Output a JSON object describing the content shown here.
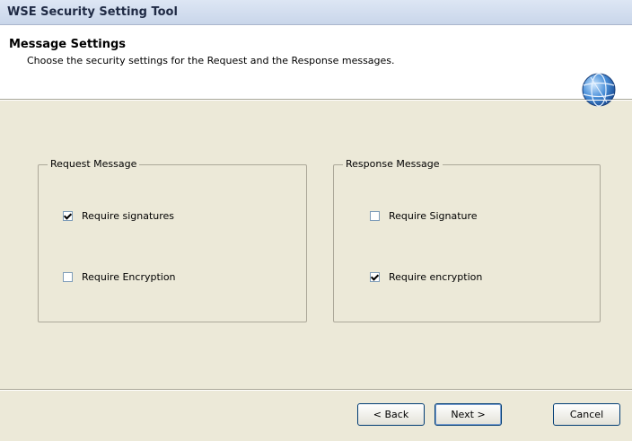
{
  "window": {
    "title": "WSE Security Setting Tool"
  },
  "header": {
    "title": "Message Settings",
    "subtitle": "Choose the security settings for the Request and the Response messages.",
    "icon": "globe-icon"
  },
  "request_group": {
    "legend": "Request Message",
    "options": [
      {
        "label": "Require signatures",
        "checked": true
      },
      {
        "label": "Require Encryption",
        "checked": false
      }
    ]
  },
  "response_group": {
    "legend": "Response Message",
    "options": [
      {
        "label": "Require Signature",
        "checked": false
      },
      {
        "label": "Require encryption",
        "checked": true
      }
    ]
  },
  "buttons": {
    "back": "< Back",
    "next": "Next >",
    "cancel": "Cancel"
  }
}
